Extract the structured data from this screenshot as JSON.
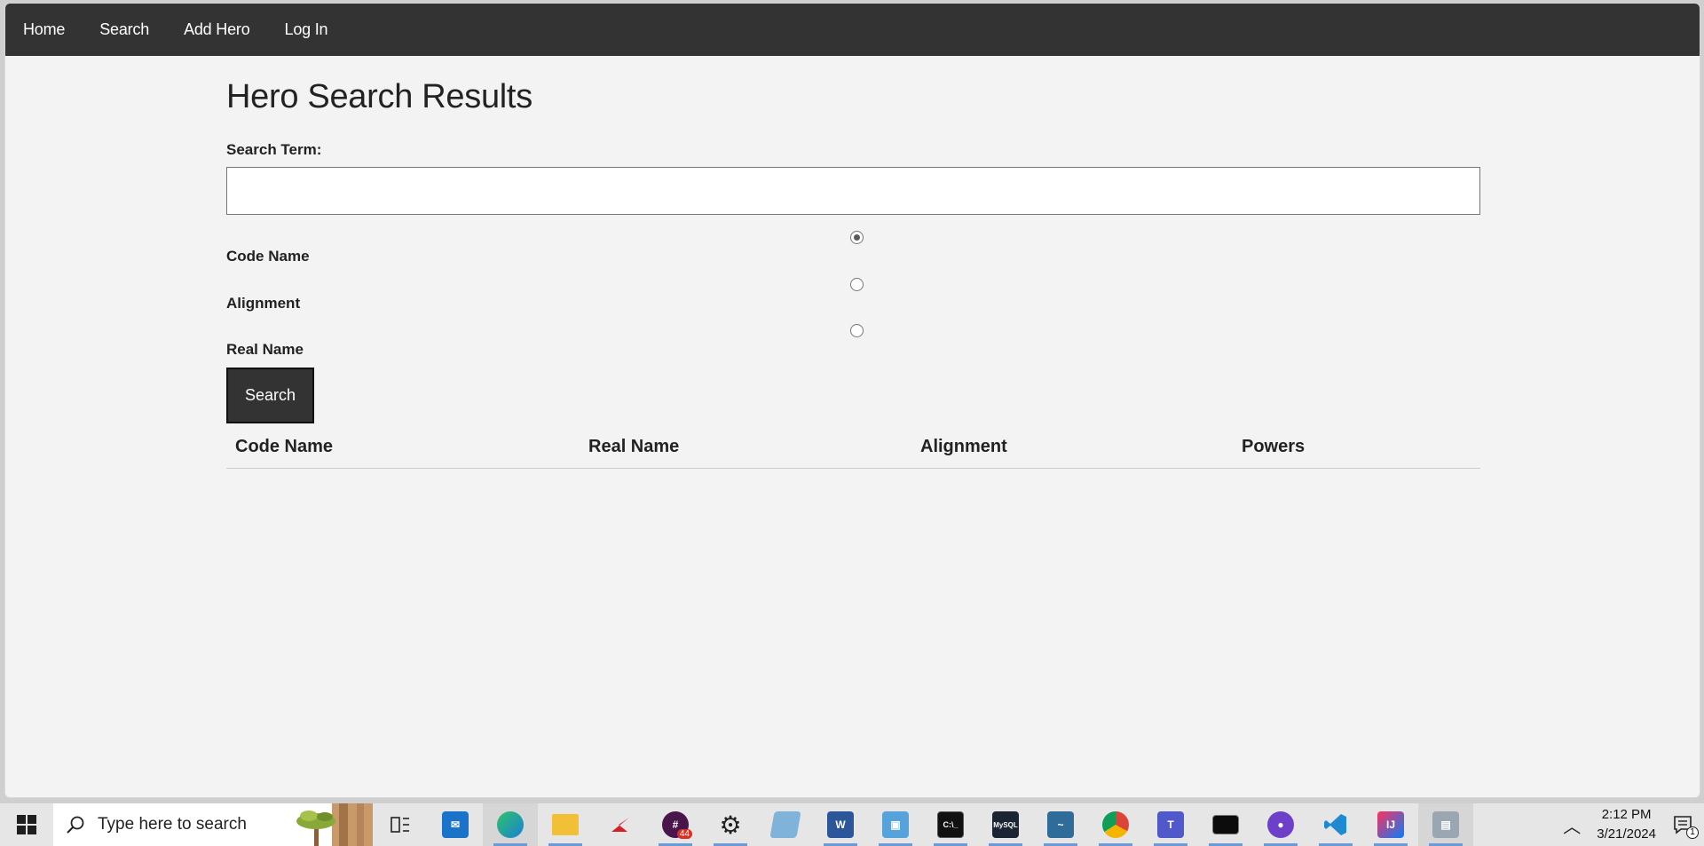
{
  "nav": {
    "items": [
      "Home",
      "Search",
      "Add Hero",
      "Log In"
    ]
  },
  "page": {
    "title": "Hero Search Results",
    "search_label": "Search Term:",
    "search_value": "",
    "radio_options": [
      {
        "label": "Code Name",
        "checked": true
      },
      {
        "label": "Alignment",
        "checked": false
      },
      {
        "label": "Real Name",
        "checked": false
      }
    ],
    "search_button": "Search",
    "table_headers": [
      "Code Name",
      "Real Name",
      "Alignment",
      "Powers"
    ]
  },
  "taskbar": {
    "search_placeholder": "Type here to search",
    "time": "2:12 PM",
    "date": "3/21/2024",
    "notification_count": "1",
    "slack_badge": "44",
    "apps": [
      "task-view",
      "mail",
      "edge",
      "file-explorer",
      "acrobat",
      "slack",
      "settings",
      "notepad",
      "word",
      "outlook",
      "terminal",
      "mysql",
      "mysql-workbench",
      "chrome",
      "teams",
      "cmd",
      "github-desktop",
      "vscode",
      "intellij",
      "remote-desktop"
    ]
  },
  "colors": {
    "navbar": "#333333",
    "page_bg": "#f3f3f3",
    "button": "#333333"
  }
}
